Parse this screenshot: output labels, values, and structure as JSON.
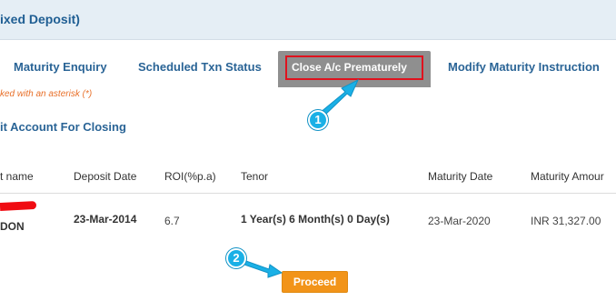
{
  "header": {
    "title": "ixed Deposit)"
  },
  "tabs": [
    {
      "label": "Maturity Enquiry"
    },
    {
      "label": "Scheduled Txn Status"
    },
    {
      "label": "Close A/c Prematurely"
    },
    {
      "label": "Modify Maturity Instruction"
    }
  ],
  "form": {
    "mandatory_note": "ked with an asterisk (*)",
    "section_heading": "it Account For Closing"
  },
  "table": {
    "columns": [
      "t name",
      "Deposit Date",
      "ROI(%p.a)",
      "Tenor",
      "Maturity Date",
      "Maturity Amour"
    ],
    "rows": [
      {
        "name": "DON",
        "deposit_date": "23-Mar-2014",
        "roi": "6.7",
        "tenor": "1 Year(s) 6 Month(s) 0 Day(s)",
        "maturity_date": "23-Mar-2020",
        "maturity_amount": "INR  31,327.00"
      }
    ]
  },
  "actions": {
    "proceed_label": "Proceed"
  },
  "annotations": [
    {
      "number": "1"
    },
    {
      "number": "2"
    }
  ],
  "colors": {
    "header_bg": "#e5eef5",
    "link_blue": "#2a6496",
    "active_tab_bg": "#8f8f8f",
    "highlight_red": "#e0121e",
    "note_orange": "#e8702a",
    "proceed_orange": "#f29419",
    "annotation_blue": "#1ab0e6"
  }
}
